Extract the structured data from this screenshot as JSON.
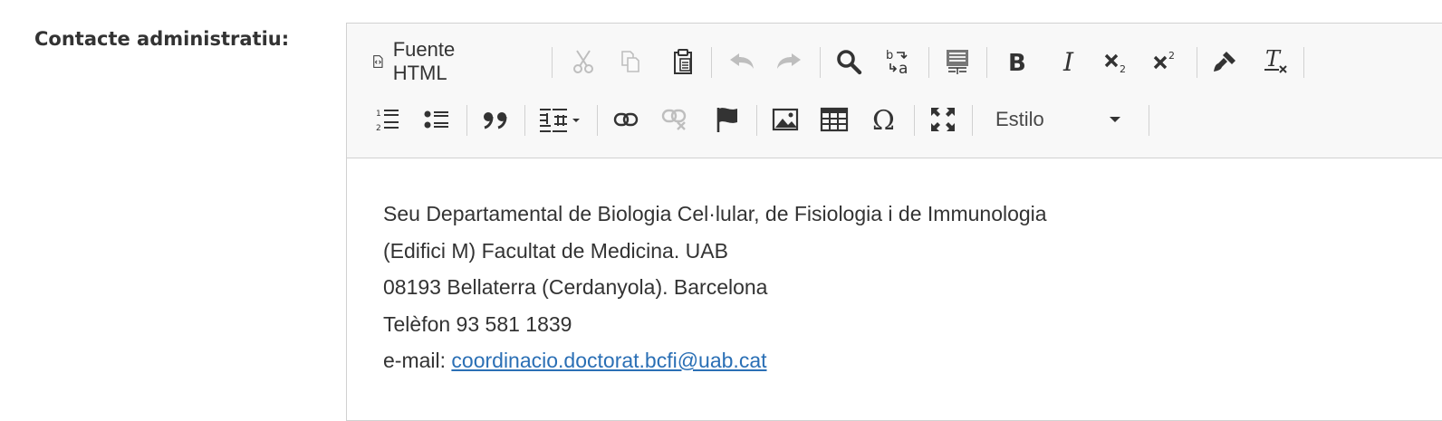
{
  "form": {
    "label": "Contacte administratiu:"
  },
  "toolbar": {
    "source_label": "Fuente HTML",
    "style_combo": "Estilo"
  },
  "icons": {
    "source": "source-icon",
    "cut": "scissors-icon",
    "copy": "copy-icon",
    "paste": "paste-icon",
    "undo": "undo-icon",
    "redo": "redo-icon",
    "find": "search-icon",
    "replace": "replace-icon",
    "select_all": "select-all-icon",
    "bold": "bold-icon",
    "italic": "italic-icon",
    "subscript": "subscript-icon",
    "superscript": "superscript-icon",
    "copy_format": "paintbrush-icon",
    "remove_format": "remove-format-icon",
    "numbered_list": "numbered-list-icon",
    "bulleted_list": "bulleted-list-icon",
    "blockquote": "blockquote-icon",
    "create_div": "create-div-icon",
    "link": "link-icon",
    "unlink": "unlink-icon",
    "anchor": "flag-icon",
    "image": "image-icon",
    "table": "table-icon",
    "special_char": "omega-icon",
    "maximize": "maximize-icon"
  },
  "content": {
    "line1": "Seu Departamental de Biologia Cel·lular, de Fisiologia i de Immunologia",
    "line2": "(Edifici M) Facultat de Medicina. UAB",
    "line3": "08193 Bellaterra (Cerdanyola). Barcelona",
    "line4": "Telèfon 93 581 1839",
    "email_prefix": "e-mail: ",
    "email": "coordinacio.doctorat.bcfi@uab.cat"
  },
  "colors": {
    "toolbar_bg": "#f8f8f8",
    "border": "#d1d1d1",
    "text": "#333333",
    "link": "#2a6fb5"
  }
}
